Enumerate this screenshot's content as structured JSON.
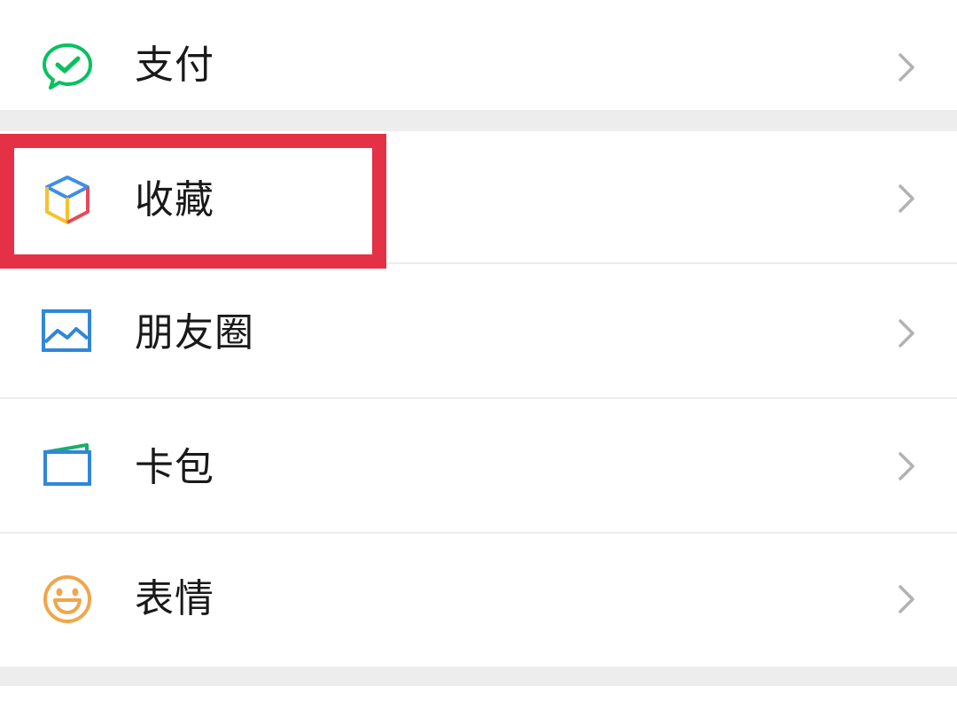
{
  "menu": {
    "items": [
      {
        "label": "支付",
        "icon": "wechat-pay-icon",
        "color": "#07c160"
      },
      {
        "label": "收藏",
        "icon": "favorites-cube-icon",
        "color": "#3d8ee8"
      },
      {
        "label": "朋友圈",
        "icon": "moments-picture-icon",
        "color": "#2f87d8"
      },
      {
        "label": "卡包",
        "icon": "card-wallet-icon",
        "color": "#2f87d8"
      },
      {
        "label": "表情",
        "icon": "sticker-smiley-icon",
        "color": "#f0a64a"
      }
    ],
    "highlighted_item": "收藏",
    "highlight_color": "#e43145",
    "chevron_color": "#b2b2b2"
  }
}
